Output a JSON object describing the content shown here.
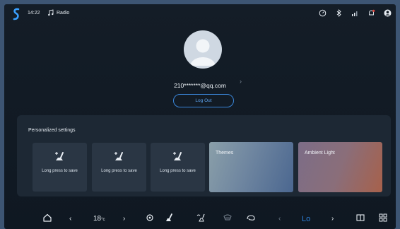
{
  "status_bar": {
    "time": "14:22",
    "source_label": "Radio",
    "icons": [
      "logo-icon",
      "music-note-icon",
      "speedometer-icon",
      "bluetooth-icon",
      "signal-icon",
      "notification-icon",
      "account-icon"
    ],
    "notification_color": "#e0443c"
  },
  "profile": {
    "email": "210*******@qq.com",
    "logout_label": "Log Out"
  },
  "personalized": {
    "title": "Personalized settings",
    "seat_presets": [
      {
        "label": "Long press to save"
      },
      {
        "label": "Long press to save"
      },
      {
        "label": "Long press to save"
      }
    ],
    "themes_label": "Themes",
    "ambient_label": "Ambient Light"
  },
  "dock": {
    "temperature_value": "18",
    "temperature_unit": "°c",
    "fan_label": "Lo",
    "accent_color": "#2d7fd8"
  }
}
